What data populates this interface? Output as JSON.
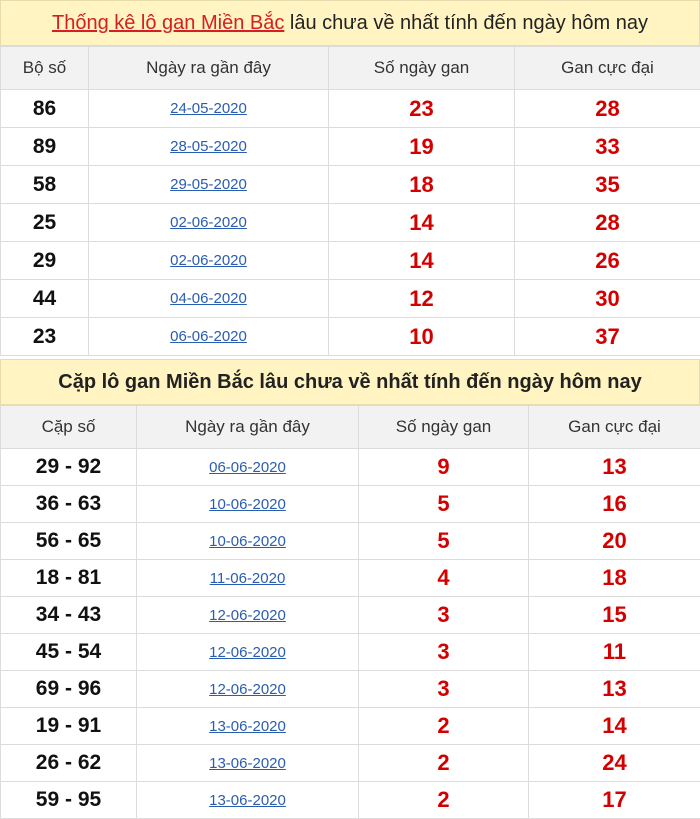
{
  "section1": {
    "title_red": "Thống kê lô gan Miền Bắc",
    "title_rest": " lâu chưa về nhất tính đến ngày hôm nay",
    "headers": [
      "Bộ số",
      "Ngày ra gần đây",
      "Số ngày gan",
      "Gan cực đại"
    ],
    "rows": [
      {
        "num": "86",
        "date": "24-05-2020",
        "days": "23",
        "max": "28"
      },
      {
        "num": "89",
        "date": "28-05-2020",
        "days": "19",
        "max": "33"
      },
      {
        "num": "58",
        "date": "29-05-2020",
        "days": "18",
        "max": "35"
      },
      {
        "num": "25",
        "date": "02-06-2020",
        "days": "14",
        "max": "28"
      },
      {
        "num": "29",
        "date": "02-06-2020",
        "days": "14",
        "max": "26"
      },
      {
        "num": "44",
        "date": "04-06-2020",
        "days": "12",
        "max": "30"
      },
      {
        "num": "23",
        "date": "06-06-2020",
        "days": "10",
        "max": "37"
      }
    ]
  },
  "section2": {
    "title": "Cặp lô gan Miền Bắc lâu chưa về nhất tính đến ngày hôm nay",
    "headers": [
      "Cặp số",
      "Ngày ra gần đây",
      "Số ngày gan",
      "Gan cực đại"
    ],
    "rows": [
      {
        "num": "29 - 92",
        "date": "06-06-2020",
        "days": "9",
        "max": "13"
      },
      {
        "num": "36 - 63",
        "date": "10-06-2020",
        "days": "5",
        "max": "16"
      },
      {
        "num": "56 - 65",
        "date": "10-06-2020",
        "days": "5",
        "max": "20"
      },
      {
        "num": "18 - 81",
        "date": "11-06-2020",
        "days": "4",
        "max": "18"
      },
      {
        "num": "34 - 43",
        "date": "12-06-2020",
        "days": "3",
        "max": "15"
      },
      {
        "num": "45 - 54",
        "date": "12-06-2020",
        "days": "3",
        "max": "11"
      },
      {
        "num": "69 - 96",
        "date": "12-06-2020",
        "days": "3",
        "max": "13"
      },
      {
        "num": "19 - 91",
        "date": "13-06-2020",
        "days": "2",
        "max": "14"
      },
      {
        "num": "26 - 62",
        "date": "13-06-2020",
        "days": "2",
        "max": "24"
      },
      {
        "num": "59 - 95",
        "date": "13-06-2020",
        "days": "2",
        "max": "17"
      }
    ]
  }
}
